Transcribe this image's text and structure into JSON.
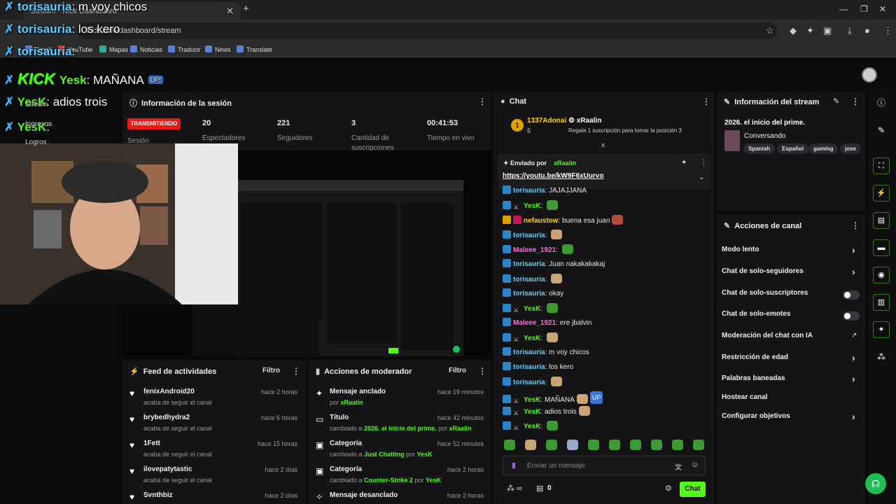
{
  "browser": {
    "tab_title": "Stream - Kick Dashboard",
    "address": "kick.com/dashboard/stream",
    "bookmarks": [
      "Gmail",
      "YouTube",
      "Mapas",
      "Noticias",
      "Traducir",
      "News",
      "Translate"
    ]
  },
  "overlay": {
    "lines": [
      {
        "user": "torisauria",
        "text": "m voy chicos"
      },
      {
        "user": "torisauria",
        "text": "los kero"
      },
      {
        "user": "torisauria",
        "text": ""
      },
      {
        "user": "Yesk",
        "text": "MAÑANA",
        "pill": "UP!"
      },
      {
        "user": "YesK",
        "text": "adios trois"
      },
      {
        "user": "YesK",
        "text": ""
      }
    ],
    "kick_label": "KICK",
    "side_labels": [
      "Stream",
      "Ingresos",
      "Logros"
    ]
  },
  "session": {
    "title": "Información de la sesión",
    "live_badge": "TRANSMITIENDO",
    "session_label": "Sesión",
    "stats": [
      {
        "value": "20",
        "label": "Espectadores"
      },
      {
        "value": "221",
        "label": "Seguidores"
      },
      {
        "value": "3",
        "label": "Cantidad de suscripciones"
      },
      {
        "value": "00:41:53",
        "label": "Tiempo en vivo"
      }
    ]
  },
  "activity_feed": {
    "title": "Feed de actividades",
    "filter": "Filtro",
    "items": [
      {
        "name": "fenixAndroid20",
        "sub": "acaba de seguir el canal",
        "time": "hace 2 horas"
      },
      {
        "name": "brybedhydra2",
        "sub": "acaba de seguir el canal",
        "time": "hace 6 horas"
      },
      {
        "name": "1Fett",
        "sub": "acaba de seguir el canal",
        "time": "hace 15 horas"
      },
      {
        "name": "ilovepatytastic",
        "sub": "acaba de seguir el canal",
        "time": "hace 2 días"
      },
      {
        "name": "Svnthbiz",
        "sub": "",
        "time": "hace 2 días"
      }
    ]
  },
  "mod_actions": {
    "title": "Acciones de moderador",
    "filter": "Filtro",
    "items": [
      {
        "title": "Mensaje anclado",
        "pre": "por",
        "hl": "xRaalin",
        "post": "",
        "by": "",
        "time": "hace 19 minutos",
        "icon": "pin"
      },
      {
        "title": "Título",
        "pre": "cambiado a",
        "hl": "2026. el inicio del prime.",
        "post": "por",
        "by": "xRaalin",
        "time": "hace 42 minutos",
        "icon": "title"
      },
      {
        "title": "Categoría",
        "pre": "cambiado a",
        "hl": "Just Chatting",
        "post": "por",
        "by": "YesK",
        "time": "hace 52 minutos",
        "icon": "category"
      },
      {
        "title": "Categoría",
        "pre": "cambiado a",
        "hl": "Counter-Strike 2",
        "post": "por",
        "by": "YesK",
        "time": "hace 2 horas",
        "icon": "category"
      },
      {
        "title": "Mensaje desanclado",
        "pre": "",
        "hl": "",
        "post": "",
        "by": "",
        "time": "hace 2 horas",
        "icon": "unpin"
      }
    ]
  },
  "chat": {
    "title": "Chat",
    "top_gifter": {
      "name": "1337Adonai",
      "count": "5",
      "rank": "1"
    },
    "leader": {
      "name": "xRaalin",
      "prompt": "Regala 1 suscripción para tomar la posición 3"
    },
    "pinned": {
      "label": "Enviado por",
      "by": "xRaalin",
      "link": "https://youtu.be/kW9F6xUurvo"
    },
    "messages": [
      {
        "user": "torisauria",
        "color": "#5fd0ff",
        "text": "JAJAJJANA",
        "badges": [
          "blue"
        ],
        "emote": ""
      },
      {
        "user": "YesK",
        "color": "#53fc18",
        "text": "",
        "badges": [
          "blue",
          "mod"
        ],
        "emote": "pepe"
      },
      {
        "user": "nefaustow",
        "color": "#ffd400",
        "text": "buena esa juan",
        "badges": [
          "gold",
          "red"
        ],
        "emote": "red"
      },
      {
        "user": "torisauria",
        "color": "#5fd0ff",
        "text": "",
        "badges": [
          "blue"
        ],
        "emote": "face"
      },
      {
        "user": "Maleee_1921",
        "color": "#ff6bd5",
        "text": "",
        "badges": [
          "blue"
        ],
        "emote": "pepe"
      },
      {
        "user": "torisauria",
        "color": "#5fd0ff",
        "text": "Juan nakakakakaj",
        "badges": [
          "blue"
        ],
        "emote": ""
      },
      {
        "user": "torisauria",
        "color": "#5fd0ff",
        "text": "",
        "badges": [
          "blue"
        ],
        "emote": "face"
      },
      {
        "user": "torisauria",
        "color": "#5fd0ff",
        "text": "okay",
        "badges": [
          "blue"
        ],
        "emote": ""
      },
      {
        "user": "YesK",
        "color": "#53fc18",
        "text": "",
        "badges": [
          "blue",
          "mod"
        ],
        "emote": "pepe"
      },
      {
        "user": "Maleee_1921",
        "color": "#ff6bd5",
        "text": "ere jbalvin",
        "badges": [
          "blue"
        ],
        "emote": ""
      },
      {
        "user": "YesK",
        "color": "#53fc18",
        "text": "",
        "badges": [
          "blue",
          "mod"
        ],
        "emote": "face"
      },
      {
        "user": "torisauria",
        "color": "#5fd0ff",
        "text": "m voy chicos",
        "badges": [
          "blue"
        ],
        "emote": ""
      },
      {
        "user": "torisauria",
        "color": "#5fd0ff",
        "text": "los kero",
        "badges": [
          "blue"
        ],
        "emote": ""
      },
      {
        "user": "torisauria",
        "color": "#5fd0ff",
        "text": "",
        "badges": [
          "blue"
        ],
        "emote": "face"
      },
      {
        "user": "YesK",
        "color": "#53fc18",
        "text": "MAÑANA",
        "badges": [
          "blue",
          "mod"
        ],
        "emote": "face",
        "pill": "UP"
      },
      {
        "user": "YesK",
        "color": "#53fc18",
        "text": "adios trois",
        "badges": [
          "blue",
          "mod"
        ],
        "emote": "face"
      },
      {
        "user": "YesK",
        "color": "#53fc18",
        "text": "",
        "badges": [
          "blue",
          "mod"
        ],
        "emote": "pepe"
      }
    ],
    "input_placeholder": "Enviar un mensaje",
    "points": "0",
    "send_label": "Chat"
  },
  "stream_info": {
    "title": "Información del stream",
    "stream_title": "2026. el inicio del prime.",
    "category": "Conversando",
    "tags": [
      "Spanish",
      "Español",
      "gaming",
      "jose"
    ]
  },
  "channel_actions": {
    "title": "Acciones de canal",
    "items": [
      {
        "label": "Modo lento",
        "control": "chevron"
      },
      {
        "label": "Chat de solo-seguidores",
        "control": "chevron"
      },
      {
        "label": "Chat de solo-suscriptores",
        "control": "toggle"
      },
      {
        "label": "Chat de solo-emotes",
        "control": "toggle"
      },
      {
        "label": "Moderación del chat con IA",
        "control": "external"
      },
      {
        "label": "Restricción de edad",
        "control": "chevron"
      },
      {
        "label": "Palabras baneadas",
        "control": "chevron"
      },
      {
        "label": "Hostear canal",
        "control": "none"
      },
      {
        "label": "Configurar objetivos",
        "control": "chevron"
      }
    ]
  },
  "colors": {
    "accent": "#53fc18",
    "live": "#e91916",
    "panel": "#141416"
  }
}
